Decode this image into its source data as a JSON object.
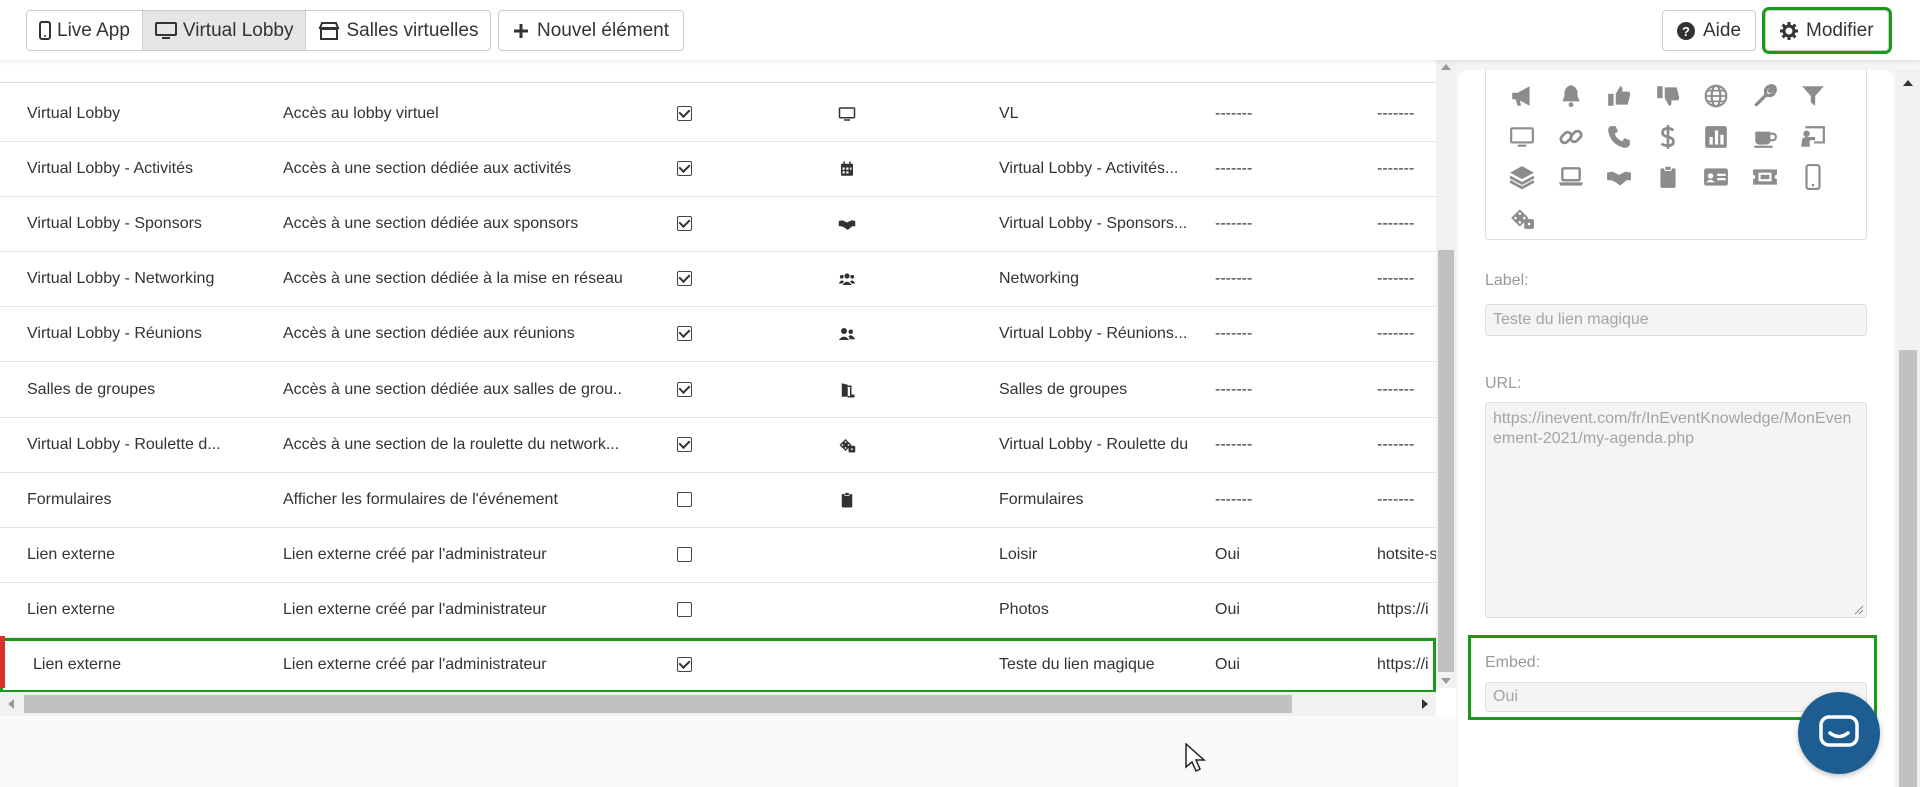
{
  "toolbar": {
    "live_app": "Live App",
    "virtual_lobby": "Virtual Lobby",
    "salles_virtuelles": "Salles virtuelles",
    "nouvel_element": "Nouvel élément",
    "aide": "Aide",
    "modifier": "Modifier"
  },
  "rows": [
    {
      "name": "Virtual Lobby",
      "description": "Accès au lobby virtuel",
      "checked": true,
      "icon": "desktop-icon",
      "label": "VL",
      "embed": "-------",
      "url": "-------"
    },
    {
      "name": "Virtual Lobby - Activités",
      "description": "Accès à une section dédiée aux activités",
      "checked": true,
      "icon": "calendar-icon",
      "label": "Virtual Lobby - Activités...",
      "embed": "-------",
      "url": "-------"
    },
    {
      "name": "Virtual Lobby - Sponsors",
      "description": "Accès à une section dédiée aux sponsors",
      "checked": true,
      "icon": "handshake-icon",
      "label": "Virtual Lobby - Sponsors...",
      "embed": "-------",
      "url": "-------"
    },
    {
      "name": "Virtual Lobby - Networking",
      "description": "Accès à une section dédiée à la mise en réseau",
      "checked": true,
      "icon": "users-icon",
      "label": "Networking",
      "embed": "-------",
      "url": "-------"
    },
    {
      "name": "Virtual Lobby - Réunions",
      "description": "Accès à une section dédiée aux réunions",
      "checked": true,
      "icon": "user-friends-icon",
      "label": "Virtual Lobby - Réunions...",
      "embed": "-------",
      "url": "-------"
    },
    {
      "name": "Salles de groupes",
      "description": "Accès à une section dédiée aux salles de grou...",
      "checked": true,
      "icon": "door-icon",
      "label": "Salles de groupes",
      "embed": "-------",
      "url": "-------"
    },
    {
      "name": "Virtual Lobby - Roulette d...",
      "description": "Accès à une section de la roulette du network...",
      "checked": true,
      "icon": "dice-icon",
      "label": "Virtual Lobby - Roulette du",
      "embed": "-------",
      "url": "-------"
    },
    {
      "name": "Formulaires",
      "description": "Afficher les formulaires de l'événement",
      "checked": false,
      "icon": "clipboard-icon",
      "label": "Formulaires",
      "embed": "-------",
      "url": "-------"
    },
    {
      "name": "Lien externe",
      "description": "Lien externe créé par l'administrateur",
      "checked": false,
      "icon": "",
      "label": "Loisir",
      "embed": "Oui",
      "url": "hotsite-s"
    },
    {
      "name": "Lien externe",
      "description": "Lien externe créé par l'administrateur",
      "checked": false,
      "icon": "",
      "label": "Photos",
      "embed": "Oui",
      "url": "https://i"
    },
    {
      "name": "Lien externe",
      "description": "Lien externe créé par l'administrateur",
      "checked": true,
      "icon": "",
      "label": "Teste du lien magique",
      "embed": "Oui",
      "url": "https://i"
    }
  ],
  "panel": {
    "icons": [
      "bullhorn-icon",
      "bell-icon",
      "thumbs-up-icon",
      "thumbs-down-icon",
      "globe-icon",
      "wrench-icon",
      "filter-icon",
      "desktop-icon",
      "link-icon",
      "phone-icon",
      "dollar-icon",
      "chart-icon",
      "coffee-icon",
      "chalkboard-icon",
      "layers-icon",
      "laptop-icon",
      "handshake-icon",
      "clipboard-icon",
      "id-card-icon",
      "ticket-icon",
      "mobile-icon",
      "dice-icon"
    ],
    "label_title": "Label:",
    "label_value": "Teste du lien magique",
    "url_title": "URL:",
    "url_value": "https://inevent.com/fr/InEventKnowledge/MonEvenement-2021/my-agenda.php",
    "embed_title": "Embed:",
    "embed_value": "Oui"
  }
}
